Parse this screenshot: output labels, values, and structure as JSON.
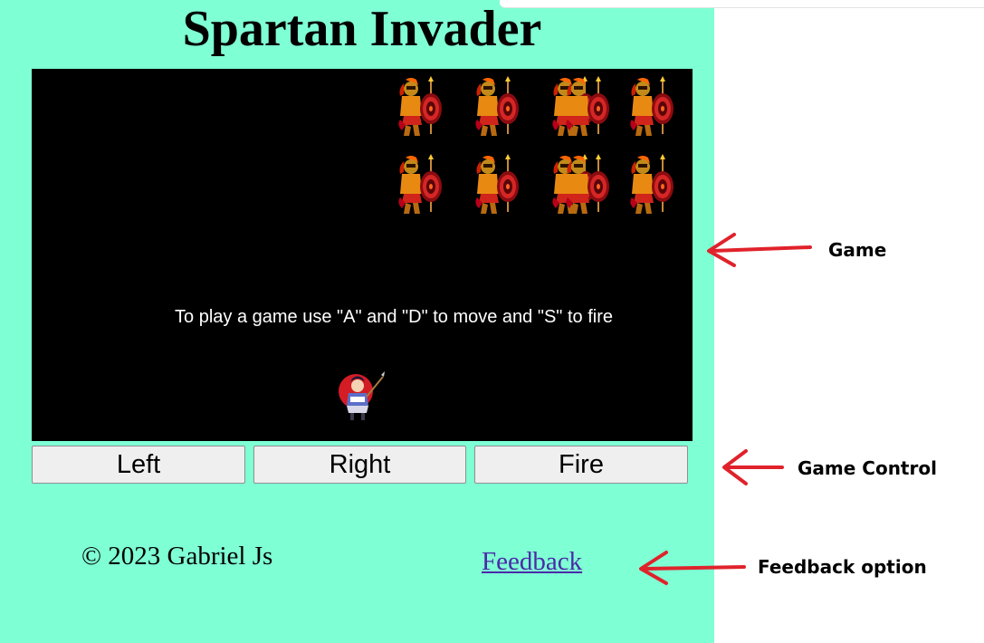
{
  "game": {
    "title": "Spartan Invader",
    "instructions": "To play a game use \"A\" and \"D\" to move and \"S\" to fire",
    "enemy_icon": "spartan-warrior",
    "player_icon": "player-soldier"
  },
  "controls": {
    "left_label": "Left",
    "right_label": "Right",
    "fire_label": "Fire"
  },
  "footer": {
    "copyright": "© 2023 Gabriel Js",
    "feedback_link": "Feedback"
  },
  "annotations": {
    "game_label": "Game",
    "controls_label": "Game Control",
    "feedback_label": "Feedback option"
  },
  "colors": {
    "page_background": "#7fffd4",
    "game_background": "#000000",
    "annotation_arrow": "#e0222b",
    "link": "#4b2aa8"
  }
}
